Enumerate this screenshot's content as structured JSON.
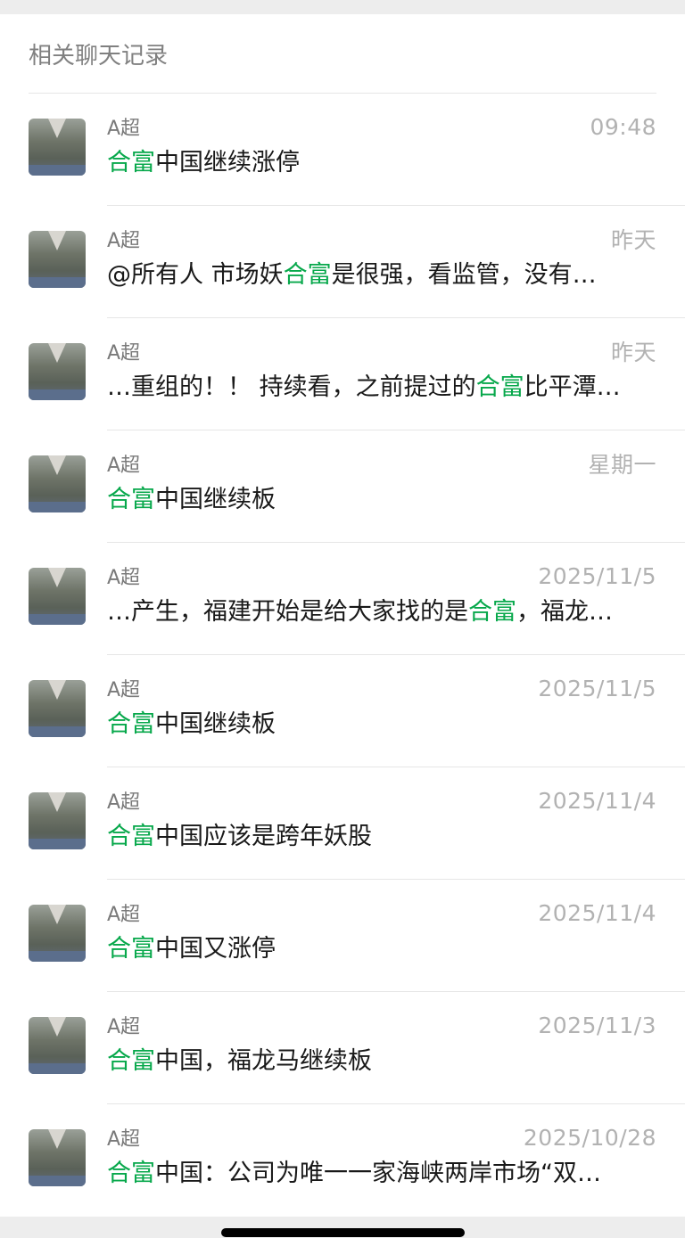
{
  "section": {
    "title": "相关聊天记录"
  },
  "highlight_color": "#07a84b",
  "results": [
    {
      "sender": "A超",
      "time": "09:48",
      "pre": "",
      "hl": "合富",
      "post": "中国继续涨停"
    },
    {
      "sender": "A超",
      "time": "昨天",
      "pre": "@所有人 市场妖",
      "hl": "合富",
      "post": "是很强，看监管，没有…"
    },
    {
      "sender": "A超",
      "time": "昨天",
      "pre": "…重组的！！ 持续看，之前提过的",
      "hl": "合富",
      "post": "比平潭…"
    },
    {
      "sender": "A超",
      "time": "星期一",
      "pre": "",
      "hl": "合富",
      "post": "中国继续板"
    },
    {
      "sender": "A超",
      "time": "2025/11/5",
      "pre": "…产生，福建开始是给大家找的是",
      "hl": "合富",
      "post": "，福龙…"
    },
    {
      "sender": "A超",
      "time": "2025/11/5",
      "pre": "",
      "hl": "合富",
      "post": "中国继续板"
    },
    {
      "sender": "A超",
      "time": "2025/11/4",
      "pre": "",
      "hl": "合富",
      "post": "中国应该是跨年妖股"
    },
    {
      "sender": "A超",
      "time": "2025/11/4",
      "pre": "",
      "hl": "合富",
      "post": "中国又涨停"
    },
    {
      "sender": "A超",
      "time": "2025/11/3",
      "pre": "",
      "hl": "合富",
      "post": "中国，福龙马继续板"
    },
    {
      "sender": "A超",
      "time": "2025/10/28",
      "pre": "",
      "hl": "合富",
      "post": "中国：公司为唯一一家海峡两岸市场“双…"
    }
  ]
}
